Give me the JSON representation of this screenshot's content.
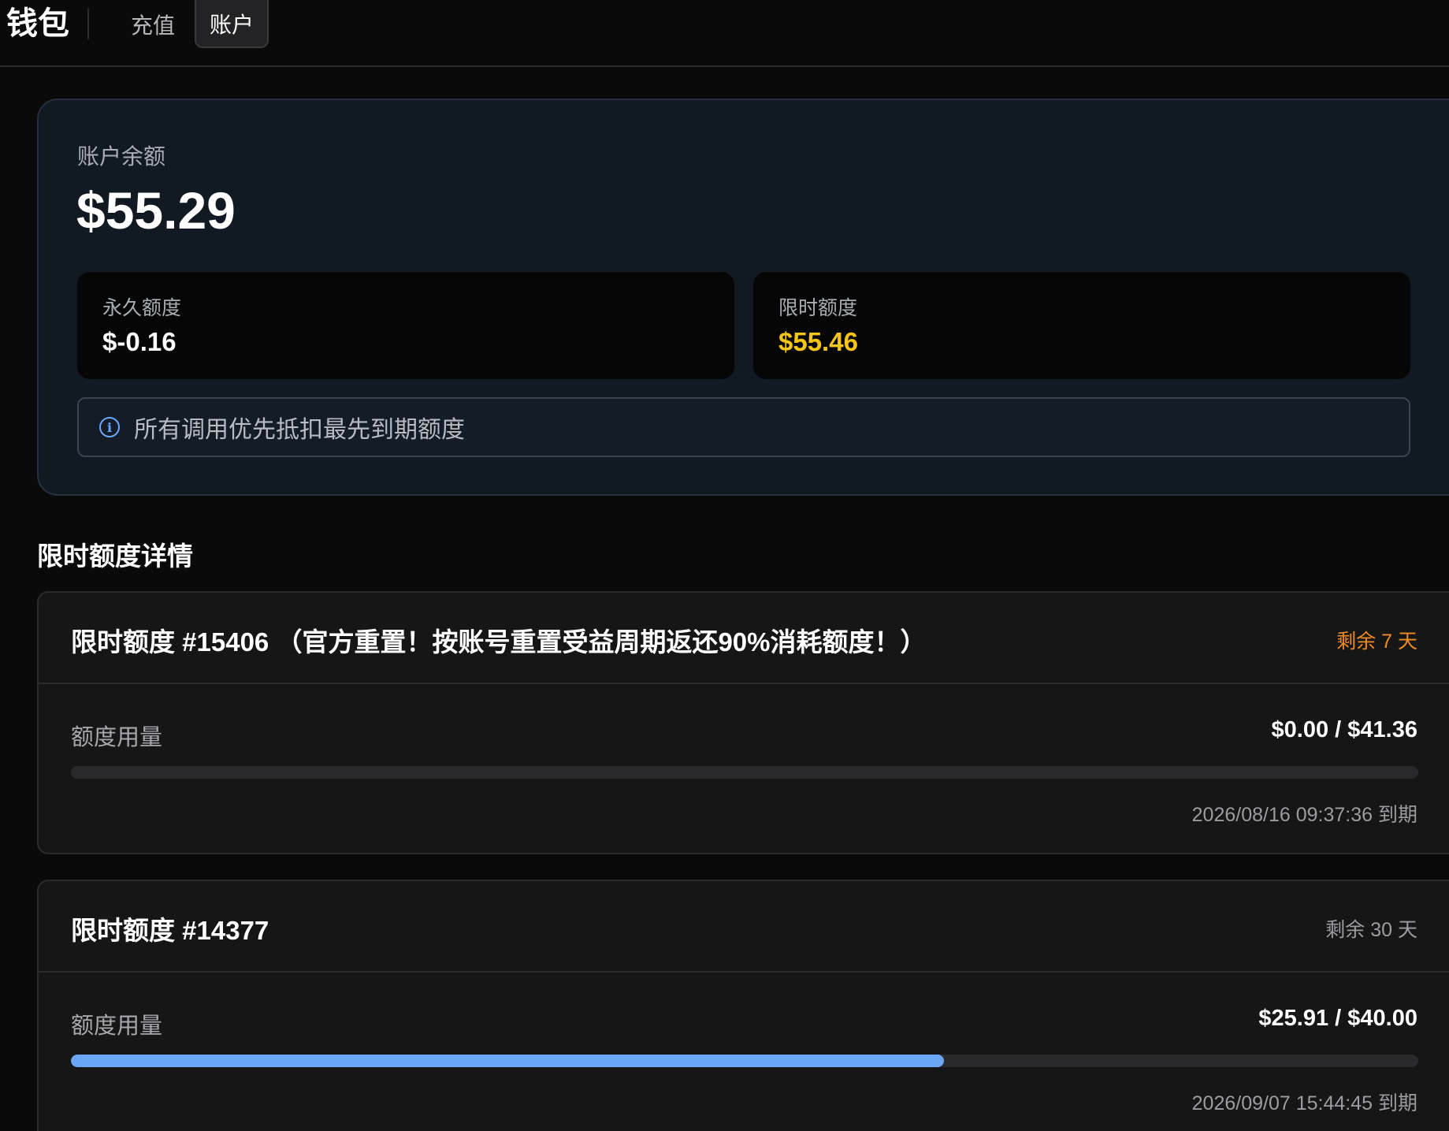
{
  "header": {
    "title": "钱包",
    "tabs": [
      {
        "label": "充值",
        "active": false
      },
      {
        "label": "账户",
        "active": true
      }
    ]
  },
  "balance": {
    "label": "账户余额",
    "value": "$55.29",
    "permanent": {
      "label": "永久额度",
      "value": "$-0.16"
    },
    "limited": {
      "label": "限时额度",
      "value": "$55.46",
      "color": "#f5c518"
    },
    "notice": "所有调用优先抵扣最先到期额度",
    "notice_icon": "info-icon"
  },
  "details": {
    "title": "限时额度详情",
    "items": [
      {
        "title": "限时额度 #15406 （官方重置！按账号重置受益周期返还90%消耗额度！）",
        "remaining": "剩余 7 天",
        "usage_label": "额度用量",
        "usage": "$0.00 / $41.36",
        "progress": 0.0,
        "expiry": "2026/08/16 09:37:36 到期"
      },
      {
        "title": "限时额度 #14377",
        "remaining": "剩余 30 天",
        "usage_label": "额度用量",
        "usage": "$25.91 / $40.00",
        "progress": 0.648,
        "expiry": "2026/09/07 15:44:45 到期"
      }
    ]
  },
  "colors": {
    "accent": "#6aa7f5",
    "warning": "#f08a24",
    "highlight": "#f5c518"
  }
}
